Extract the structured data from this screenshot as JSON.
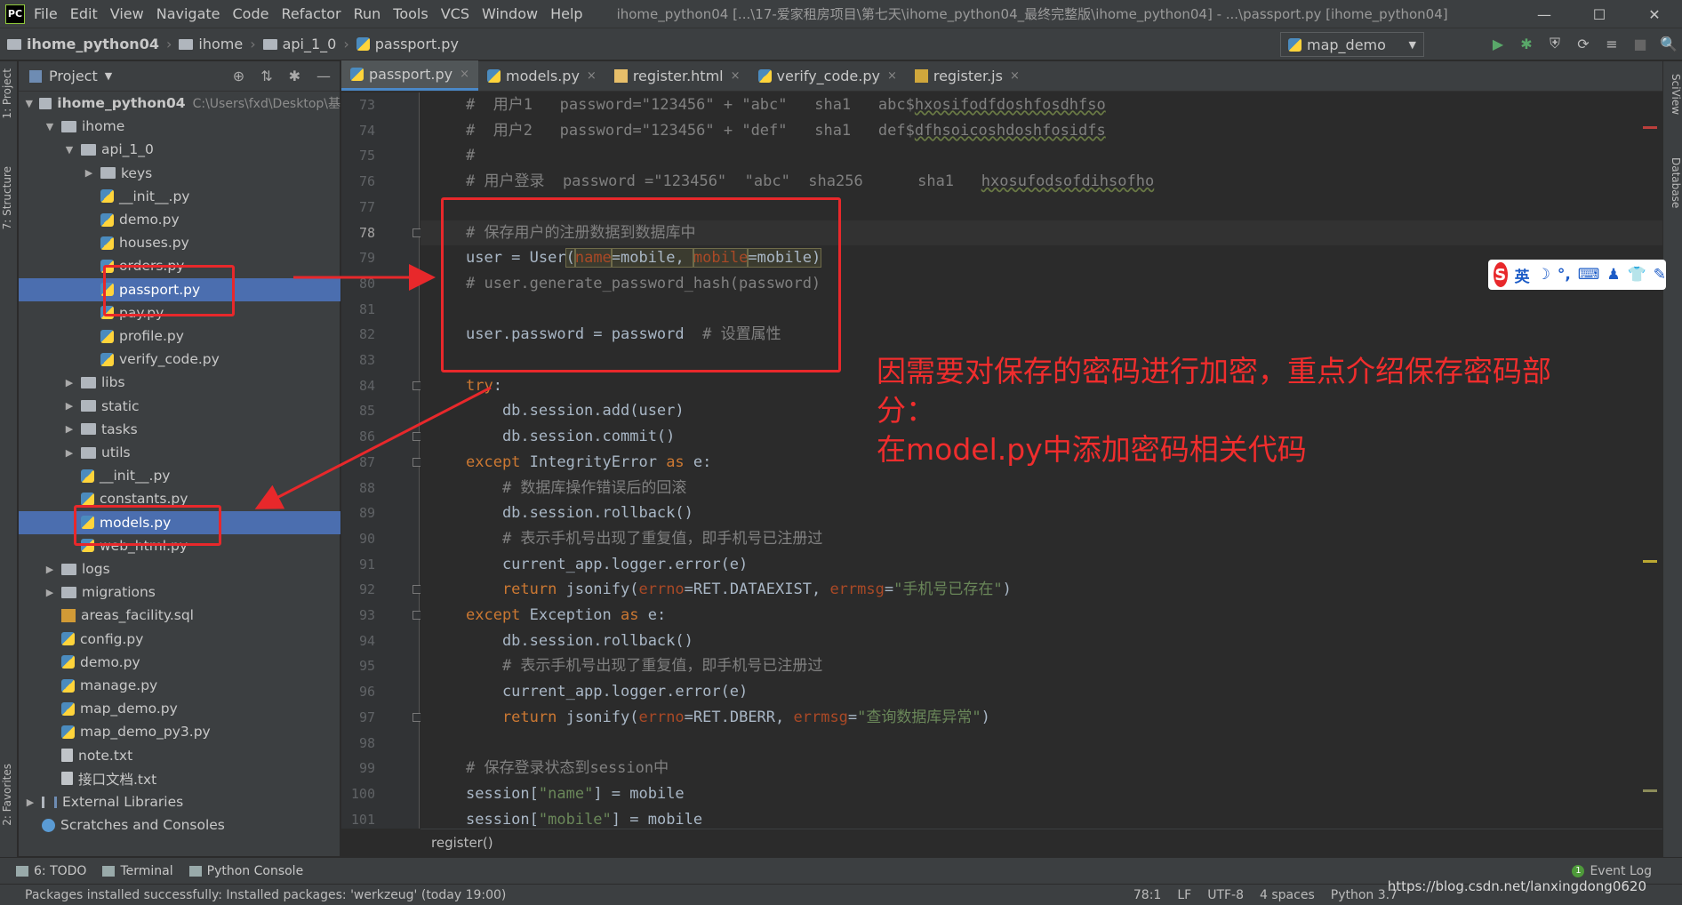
{
  "menubar": {
    "logo": "PC",
    "items": [
      "File",
      "Edit",
      "View",
      "Navigate",
      "Code",
      "Refactor",
      "Run",
      "Tools",
      "VCS",
      "Window",
      "Help"
    ],
    "title": "ihome_python04 [...\\17-爱家租房项目\\第七天\\ihome_python04_最终完整版\\ihome_python04] - ...\\passport.py [ihome_python04]",
    "win": [
      "—",
      "☐",
      "✕"
    ]
  },
  "navbar": {
    "crumbs": [
      "ihome_python04",
      "ihome",
      "api_1_0",
      "passport.py"
    ],
    "run_config": "map_demo",
    "tool_icons": [
      "▶",
      "✱",
      "⛨",
      "⟳",
      "≡",
      "■",
      "🔍"
    ]
  },
  "left_strip": {
    "project": "1: Project",
    "structure": "7: Structure",
    "favorites": "2: Favorites"
  },
  "right_strip": {
    "sciview": "SciView",
    "database": "Database"
  },
  "project_panel": {
    "title": "Project",
    "header_icons": [
      "⊕",
      "⇅",
      "✱",
      "—"
    ],
    "tree": [
      {
        "label": "ihome_python04",
        "path": "C:\\Users\\fxd\\Desktop\\基",
        "kind": "folder",
        "arrow": "▼",
        "bold": true
      },
      {
        "label": "ihome",
        "kind": "folder",
        "arrow": "▼"
      },
      {
        "label": "api_1_0",
        "kind": "folder",
        "arrow": "▼"
      },
      {
        "label": "keys",
        "kind": "folder",
        "arrow": "▶"
      },
      {
        "label": "__init__.py",
        "kind": "py"
      },
      {
        "label": "demo.py",
        "kind": "py"
      },
      {
        "label": "houses.py",
        "kind": "py"
      },
      {
        "label": "orders.py",
        "kind": "py"
      },
      {
        "label": "passport.py",
        "kind": "py",
        "selected": true
      },
      {
        "label": "pay.py",
        "kind": "py"
      },
      {
        "label": "profile.py",
        "kind": "py"
      },
      {
        "label": "verify_code.py",
        "kind": "py"
      },
      {
        "label": "libs",
        "kind": "folder",
        "arrow": "▶"
      },
      {
        "label": "static",
        "kind": "folder",
        "arrow": "▶"
      },
      {
        "label": "tasks",
        "kind": "folder",
        "arrow": "▶"
      },
      {
        "label": "utils",
        "kind": "folder",
        "arrow": "▶"
      },
      {
        "label": "__init__.py",
        "kind": "py"
      },
      {
        "label": "constants.py",
        "kind": "py"
      },
      {
        "label": "models.py",
        "kind": "py",
        "selected": true
      },
      {
        "label": "web_html.py",
        "kind": "py"
      },
      {
        "label": "logs",
        "kind": "folder",
        "arrow": "▶"
      },
      {
        "label": "migrations",
        "kind": "folder",
        "arrow": "▶"
      },
      {
        "label": "areas_facility.sql",
        "kind": "sql"
      },
      {
        "label": "config.py",
        "kind": "py"
      },
      {
        "label": "demo.py",
        "kind": "py"
      },
      {
        "label": "manage.py",
        "kind": "py"
      },
      {
        "label": "map_demo.py",
        "kind": "py"
      },
      {
        "label": "map_demo_py3.py",
        "kind": "py"
      },
      {
        "label": "note.txt",
        "kind": "txt"
      },
      {
        "label": "接口文档.txt",
        "kind": "txt"
      },
      {
        "label": "External Libraries",
        "kind": "lib",
        "arrow": "▶"
      },
      {
        "label": "Scratches and Consoles",
        "kind": "scr"
      }
    ]
  },
  "tabs": [
    {
      "label": "passport.py",
      "icon": "py",
      "active": true
    },
    {
      "label": "models.py",
      "icon": "py"
    },
    {
      "label": "register.html",
      "icon": "html"
    },
    {
      "label": "verify_code.py",
      "icon": "py"
    },
    {
      "label": "register.js",
      "icon": "js"
    }
  ],
  "editor": {
    "current_line": 78,
    "lines": [
      {
        "n": 73,
        "segs": [
          [
            "cm",
            "#  用户1   password=\"123456\" + \"abc\"   sha1   abc$"
          ],
          [
            "cm ul",
            "hxosifodfdoshfosdhfso"
          ]
        ]
      },
      {
        "n": 74,
        "segs": [
          [
            "cm",
            "#  用户2   password=\"123456\" + \"def\"   sha1   def$"
          ],
          [
            "cm ul",
            "dfhsoicoshdoshfosidfs"
          ]
        ]
      },
      {
        "n": 75,
        "segs": [
          [
            "cm",
            "#"
          ]
        ]
      },
      {
        "n": 76,
        "segs": [
          [
            "cm",
            "# 用户登录  password =\"123456\"  \"abc\"  sha256      sha1   "
          ],
          [
            "cm ul",
            "hxosufodsofdihsofho"
          ]
        ]
      },
      {
        "n": 77,
        "segs": []
      },
      {
        "n": 78,
        "segs": [
          [
            "cm",
            "# 保存用户的注册数据到数据库中"
          ]
        ]
      },
      {
        "n": 79,
        "segs": [
          [
            "",
            "user = User"
          ],
          [
            "hl",
            "("
          ],
          [
            "pm hl",
            "name"
          ],
          [
            "hl",
            "=mobile, "
          ],
          [
            "pm hl",
            "mobile"
          ],
          [
            "hl",
            "=mobile)"
          ]
        ]
      },
      {
        "n": 80,
        "segs": [
          [
            "cm",
            "# user.generate_password_hash(password)"
          ]
        ]
      },
      {
        "n": 81,
        "segs": []
      },
      {
        "n": 82,
        "segs": [
          [
            "",
            "user.password = password  "
          ],
          [
            "cm",
            "# 设置属性"
          ]
        ]
      },
      {
        "n": 83,
        "segs": []
      },
      {
        "n": 84,
        "segs": [
          [
            "kw",
            "try"
          ],
          [
            "",
            ":"
          ]
        ]
      },
      {
        "n": 85,
        "segs": [
          [
            "",
            "    db.session.add(user)"
          ]
        ]
      },
      {
        "n": 86,
        "segs": [
          [
            "",
            "    db.session.commit()"
          ]
        ]
      },
      {
        "n": 87,
        "segs": [
          [
            "kw",
            "except "
          ],
          [
            "",
            "IntegrityError "
          ],
          [
            "kw",
            "as "
          ],
          [
            "",
            "e:"
          ]
        ]
      },
      {
        "n": 88,
        "segs": [
          [
            "cm",
            "    # 数据库操作错误后的回滚"
          ]
        ]
      },
      {
        "n": 89,
        "segs": [
          [
            "",
            "    db.session.rollback()"
          ]
        ]
      },
      {
        "n": 90,
        "segs": [
          [
            "cm",
            "    # 表示手机号出现了重复值，即手机号已注册过"
          ]
        ]
      },
      {
        "n": 91,
        "segs": [
          [
            "",
            "    current_app.logger.error(e)"
          ]
        ]
      },
      {
        "n": 92,
        "segs": [
          [
            "kw",
            "    return "
          ],
          [
            "",
            "jsonify("
          ],
          [
            "pm",
            "errno"
          ],
          [
            "",
            "=RET.DATAEXIST, "
          ],
          [
            "pm",
            "errmsg"
          ],
          [
            "",
            "="
          ],
          [
            "st",
            "\"手机号已存在\""
          ],
          [
            "",
            ")"
          ]
        ]
      },
      {
        "n": 93,
        "segs": [
          [
            "kw",
            "except "
          ],
          [
            "",
            "Exception "
          ],
          [
            "kw",
            "as "
          ],
          [
            "",
            "e:"
          ]
        ]
      },
      {
        "n": 94,
        "segs": [
          [
            "",
            "    db.session.rollback()"
          ]
        ]
      },
      {
        "n": 95,
        "segs": [
          [
            "cm",
            "    # 表示手机号出现了重复值，即手机号已注册过"
          ]
        ]
      },
      {
        "n": 96,
        "segs": [
          [
            "",
            "    current_app.logger.error(e)"
          ]
        ]
      },
      {
        "n": 97,
        "segs": [
          [
            "kw",
            "    return "
          ],
          [
            "",
            "jsonify("
          ],
          [
            "pm",
            "errno"
          ],
          [
            "",
            "=RET.DBERR, "
          ],
          [
            "pm",
            "errmsg"
          ],
          [
            "",
            "="
          ],
          [
            "st",
            "\"查询数据库异常\""
          ],
          [
            "",
            ")"
          ]
        ]
      },
      {
        "n": 98,
        "segs": []
      },
      {
        "n": 99,
        "segs": [
          [
            "cm",
            "# 保存登录状态到session中"
          ]
        ]
      },
      {
        "n": 100,
        "segs": [
          [
            "",
            "session["
          ],
          [
            "st",
            "\"name\""
          ],
          [
            "",
            "] = mobile"
          ]
        ]
      },
      {
        "n": 101,
        "segs": [
          [
            "",
            "session["
          ],
          [
            "st",
            "\"mobile\""
          ],
          [
            "",
            "] = mobile"
          ]
        ]
      }
    ],
    "breadcrumb": "register()"
  },
  "annotation": {
    "line1": "因需要对保存的密码进行加密，重点介绍保存密码部分：",
    "line2": "在model.py中添加密码相关代码",
    "color": "#f02d2d"
  },
  "ime": {
    "logo": "S",
    "items": [
      "英",
      "☽",
      "°,",
      "⌨",
      "♟",
      "👕",
      "✎"
    ]
  },
  "bottom_tools": {
    "todo": "6: TODO",
    "terminal": "Terminal",
    "python_console": "Python Console",
    "event_count": "1",
    "event_log": "Event Log"
  },
  "status": {
    "message": "Packages installed successfully: Installed packages: 'werkzeug' (today 19:00)",
    "position": "78:1",
    "line_sep": "LF",
    "encoding": "UTF-8",
    "indent": "4 spaces",
    "interpreter": "Python 3.7",
    "watermark": "https://blog.csdn.net/lanxingdong0620"
  }
}
